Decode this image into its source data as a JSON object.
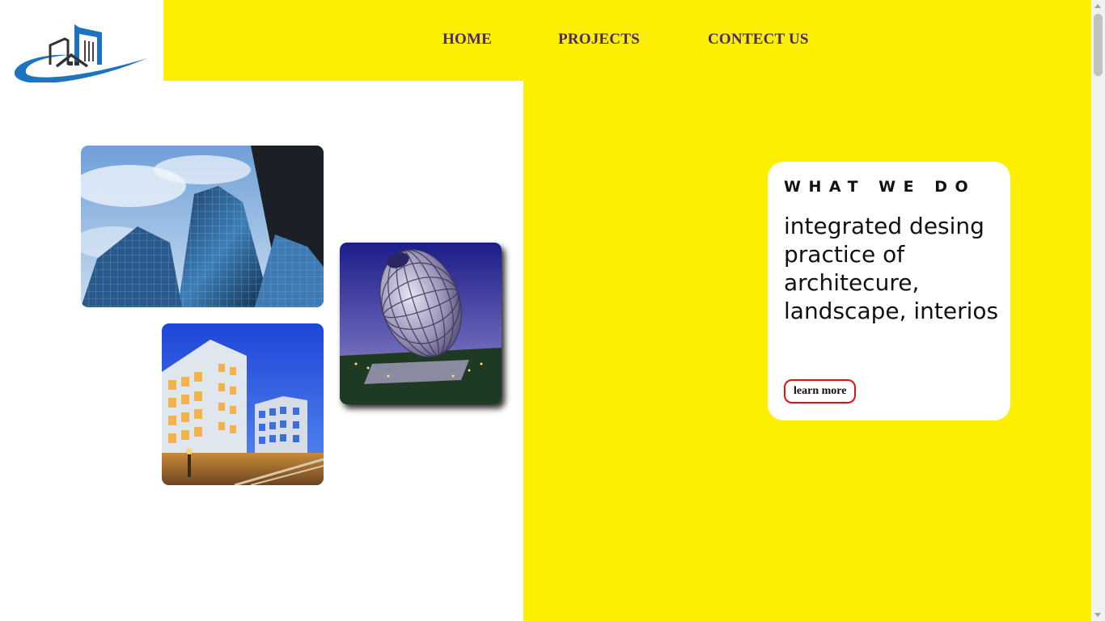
{
  "header": {
    "logo_icon": "building-logo-icon",
    "nav": [
      {
        "label": "HOME"
      },
      {
        "label": "PROJECTS"
      },
      {
        "label": "CONTECT US"
      }
    ]
  },
  "gallery": [
    {
      "icon": "glass-skyscraper-photo"
    },
    {
      "icon": "apartment-building-photo"
    },
    {
      "icon": "egg-shaped-building-photo"
    }
  ],
  "card": {
    "eyebrow": "WHAT WE DO",
    "heading": "integrated desing practice of architecure, landscape, interios",
    "button": "learn more"
  },
  "colors": {
    "accent_yellow": "#fdef00",
    "nav_text": "#4b2a6b",
    "button_border": "#e01010",
    "logo_blue": "#1e73be"
  }
}
